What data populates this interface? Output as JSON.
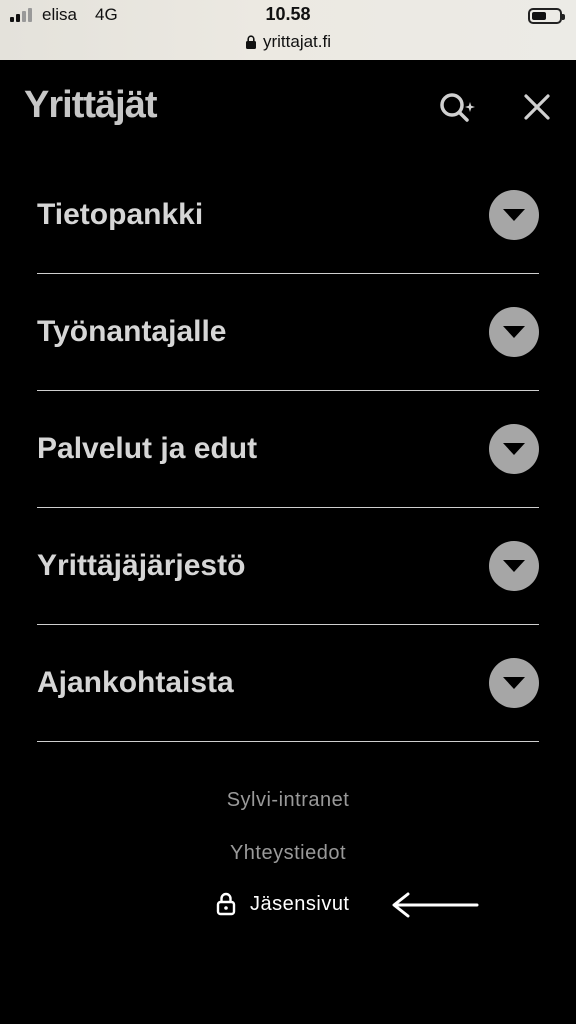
{
  "status_bar": {
    "carrier": "elisa",
    "network": "4G",
    "time": "10.58",
    "url": "yrittajat.fi"
  },
  "header": {
    "logo": "Yrittäjät",
    "search_icon": "search-sparkle-icon",
    "close_icon": "close-icon"
  },
  "menu": {
    "items": [
      {
        "label": "Tietopankki"
      },
      {
        "label": "Työnantajalle"
      },
      {
        "label": "Palvelut ja edut"
      },
      {
        "label": "Yrittäjäjärjestö"
      },
      {
        "label": "Ajankohtaista"
      }
    ],
    "toggle_icon": "chevron-down-icon"
  },
  "footer": {
    "links": [
      {
        "label": "Sylvi-intranet"
      },
      {
        "label": "Yhteystiedot"
      }
    ],
    "members_label": "Jäsensivut",
    "members_icon": "lock-icon"
  },
  "colors": {
    "background": "#000000",
    "menu_text": "#d6d6d6",
    "toggle": "#a6a6a6",
    "footer_link": "#9a9a9a"
  }
}
